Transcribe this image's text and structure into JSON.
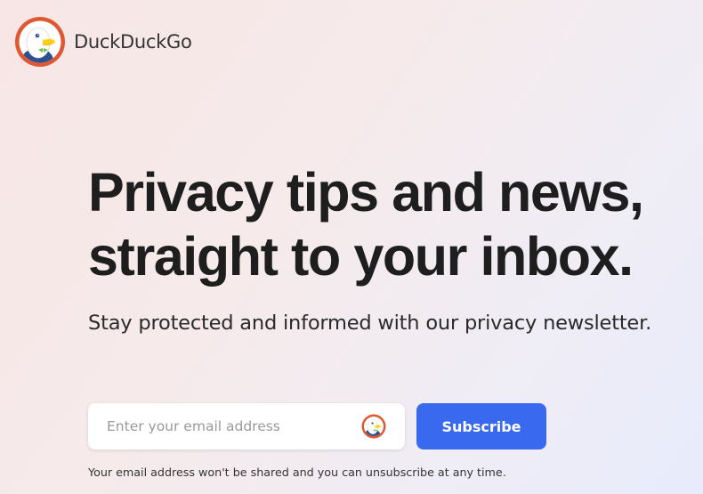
{
  "header": {
    "logo_text": "DuckDuckGo",
    "logo_icon": "duckduckgo-duck-icon"
  },
  "hero": {
    "headline_line1": "Privacy tips and news,",
    "headline_line2": "straight to your inbox.",
    "subtitle": "Stay protected and informed with our privacy newsletter."
  },
  "signup": {
    "email_placeholder": "Enter your email address",
    "email_value": "",
    "input_icon": "duckduckgo-logo-icon",
    "subscribe_label": "Subscribe",
    "disclaimer": "Your email address won't be shared and you can unsubscribe at any time."
  },
  "colors": {
    "brand_orange": "#de5833",
    "button_blue": "#3969ef",
    "text_dark": "#1e1e1e"
  }
}
